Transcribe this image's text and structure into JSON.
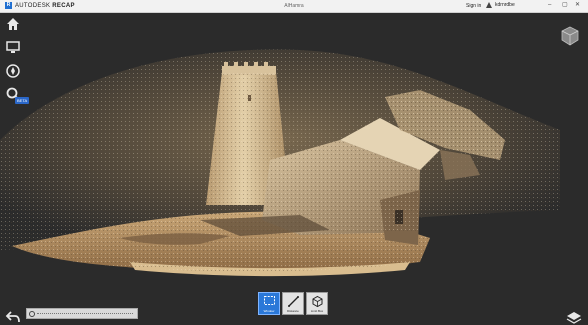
{
  "app": {
    "brand_prefix": "AUTODESK",
    "brand_product": "RECAP",
    "document_title": "AlHamra",
    "signin_label": "Sign in",
    "account_name": "kdrnrdbe",
    "window_controls": [
      "–",
      "▢",
      "✕"
    ]
  },
  "sidebar": {
    "items": [
      {
        "name": "home",
        "icon": "home-icon"
      },
      {
        "name": "display",
        "icon": "monitor-icon"
      },
      {
        "name": "navigate",
        "icon": "compass-icon"
      },
      {
        "name": "search",
        "icon": "magnifier-icon"
      }
    ],
    "beta_badge": "BETA"
  },
  "toolbar": {
    "tools": [
      {
        "label": "Window",
        "icon": "window-select-icon",
        "active": true
      },
      {
        "label": "Distance",
        "icon": "measure-distance-icon",
        "active": false
      },
      {
        "label": "Limit Box",
        "icon": "limit-box-icon",
        "active": false
      }
    ]
  },
  "colors": {
    "background": "#2b2b2b",
    "accent": "#2a78d8",
    "sand": "#d6b98a"
  }
}
